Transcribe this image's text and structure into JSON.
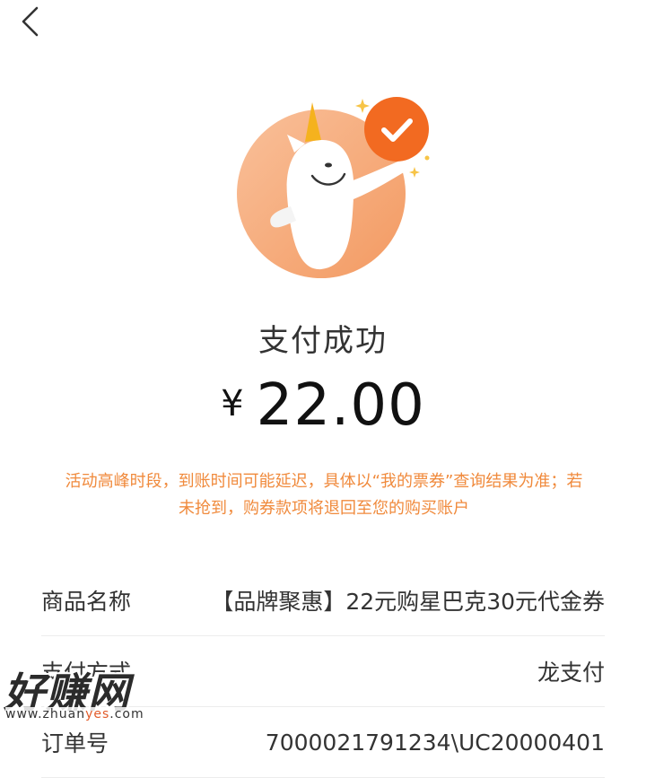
{
  "nav": {
    "back_icon": "chevron-left-icon"
  },
  "result": {
    "title": "支付成功",
    "currency": "¥",
    "amount": "22.00",
    "notice": "活动高峰时段，到账时间可能延迟，具体以“我的票券”查询结果为准；若未抢到，购券款项将退回至您的购买账户"
  },
  "details": [
    {
      "label": "商品名称",
      "value": "【品牌聚惠】22元购星巴克30元代金券"
    },
    {
      "label": "支付方式",
      "value": "龙支付"
    },
    {
      "label": "订单号",
      "value": "7000021791234\\UC20000401"
    }
  ],
  "watermark": {
    "main": "好赚网",
    "url_prefix": "www.zhuan",
    "url_highlight": "yes",
    "url_suffix": ".com"
  },
  "colors": {
    "accent": "#f08a3c",
    "check_badge": "#f26a21",
    "hero_circle": "#f7b07e"
  }
}
